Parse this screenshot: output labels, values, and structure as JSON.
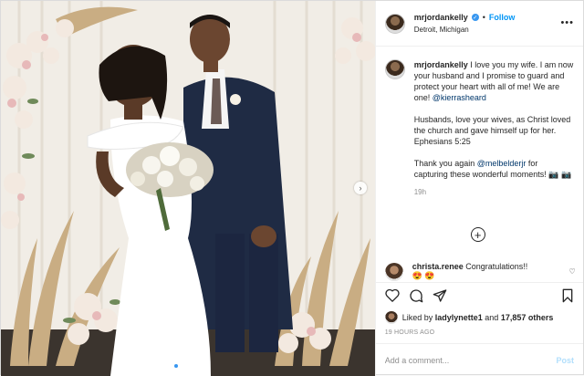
{
  "post": {
    "username": "mrjordankelly",
    "follow_label": "Follow",
    "location": "Detroit, Michigan",
    "more_label": "•••",
    "caption_username": "mrjordankelly",
    "caption_p1": " I love you my wife. I am now your husband and I promise to guard and protect your heart with all of me! We are one! ",
    "caption_mention1": "@kierrasheard",
    "caption_p2": "Husbands, love your wives, as Christ loved the church and gave himself up for her. Ephesians 5:25",
    "caption_p3_pre": "Thank you again ",
    "caption_mention2": "@melbelderjr",
    "caption_p3_post": " for capturing these wonderful moments! 📷 📷",
    "caption_time": "19h"
  },
  "load_more_icon": "plus-circle-icon",
  "comment": {
    "username": "christa.renee",
    "text": " Congratulations!!",
    "emoji_line": "😍 😍"
  },
  "likes": {
    "prefix": "Liked by ",
    "user": "ladylynette1",
    "middle": " and ",
    "count": "17,857 others"
  },
  "posted_time": "19 HOURS AGO",
  "add_comment": {
    "placeholder": "Add a comment...",
    "post_label": "Post"
  },
  "carousel": {
    "slide_count": 5,
    "active_index": 0
  },
  "colors": {
    "accent": "#0095f6",
    "post_disabled": "#b2dffc",
    "dress": "#ffffff",
    "suit": "#1f2b44"
  }
}
